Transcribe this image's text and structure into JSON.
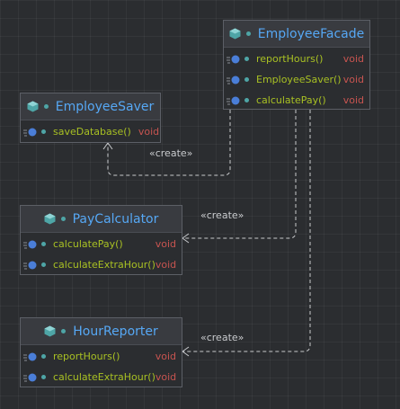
{
  "classes": {
    "facade": {
      "name": "EmployeeFacade",
      "members": [
        {
          "name": "reportHours()",
          "type": "void"
        },
        {
          "name": "EmployeeSaver()",
          "type": "void"
        },
        {
          "name": "calculatePay()",
          "type": "void"
        }
      ]
    },
    "saver": {
      "name": "EmployeeSaver",
      "members": [
        {
          "name": "saveDatabase()",
          "type": "void"
        }
      ]
    },
    "pay": {
      "name": "PayCalculator",
      "members": [
        {
          "name": "calculatePay()",
          "type": "void"
        },
        {
          "name": "calculateExtraHour()",
          "type": "void"
        }
      ]
    },
    "reporter": {
      "name": "HourReporter",
      "members": [
        {
          "name": "reportHours()",
          "type": "void"
        },
        {
          "name": "calculateExtraHour()",
          "type": "void"
        }
      ]
    }
  },
  "relations": {
    "saver_label": "«create»",
    "pay_label": "«create»",
    "reporter_label": "«create»"
  },
  "colors": {
    "class_name": "#56a8f5",
    "method_name": "#a8c023",
    "return_type": "#c75450",
    "edge": "#c8cacd"
  },
  "icons": {
    "class": "class-icon",
    "member": "method-icon",
    "visibility": "public-dot-icon"
  }
}
